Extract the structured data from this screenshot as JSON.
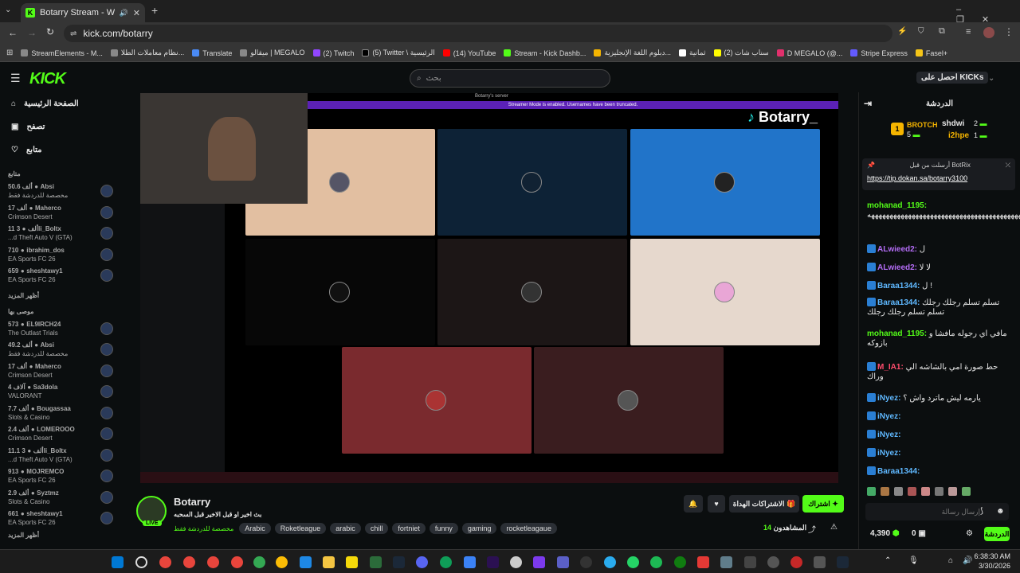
{
  "browser": {
    "tab_title": "Botarry Stream - Watch Live",
    "url": "kick.com/botarry",
    "bookmarks": [
      "StreamElements - M...",
      "نظام معاملات الطلا...",
      "Translate",
      "ميقالو | MEGALO",
      "(2) Twitch",
      "(5) Twitter \\ الرئيسية",
      "(14) YouTube",
      "Stream - Kick Dashb...",
      "دبلوم اللغة الإنجليزية...",
      "ثمانية",
      "(2) سناب شات",
      "D MEGALO (@...",
      "Stripe Express",
      "Fasel+"
    ]
  },
  "header": {
    "logo": "KICK",
    "search_placeholder": "بحث",
    "get_kicks": "احصل على KICKs"
  },
  "nav": {
    "home": "الصفحة الرئيسية",
    "browse": "تصفح",
    "following": "متابع"
  },
  "sidebar": {
    "following_title": "متابع",
    "following": [
      {
        "name": "Absi",
        "count": "50.6 ألف",
        "sub": "مخصصة للدردشة فقط"
      },
      {
        "name": "Maherco",
        "count": "17 ألف",
        "sub": "Crimson Desert"
      },
      {
        "name": "3li_Boltx",
        "count": "11 ألف",
        "sub": "...d Theft Auto V (GTA)"
      },
      {
        "name": "ibrahim_dos",
        "count": "710",
        "sub": "EA Sports FC 26"
      },
      {
        "name": "sheshtawy1",
        "count": "659",
        "sub": "EA Sports FC 26"
      }
    ],
    "show_more": "أظهر المزيد",
    "recommended_title": "موصى بها",
    "recommended": [
      {
        "name": "EL9IRCH24",
        "count": "573",
        "sub": "The Outlast Trials"
      },
      {
        "name": "Absi",
        "count": "49.2 ألف",
        "sub": "مخصصة للدردشة فقط"
      },
      {
        "name": "Maherco",
        "count": "17 ألف",
        "sub": "Crimson Desert"
      },
      {
        "name": "Sa3dola",
        "count": "4 آلاف",
        "sub": "VALORANT"
      },
      {
        "name": "Bougassaa",
        "count": "7.7 ألف",
        "sub": "Slots & Casino"
      },
      {
        "name": "LOMEROOO",
        "count": "2.4 ألف",
        "sub": "Crimson Desert"
      },
      {
        "name": "3li_Boltx",
        "count": "11.1 ألف",
        "sub": "...d Theft Auto V (GTA)"
      },
      {
        "name": "MOJREMCO",
        "count": "913",
        "sub": "EA Sports FC 26"
      },
      {
        "name": "Syztmz",
        "count": "2.9 ألف",
        "sub": "Slots & Casino"
      },
      {
        "name": "sheshtawy1",
        "count": "661",
        "sub": "EA Sports FC 26"
      }
    ],
    "show_more2": "أظهر المزيد"
  },
  "video": {
    "overlay_brand": "Botarry_",
    "banner": "Streamer Mode is enabled. Usernames have been truncated.",
    "server": "Botarry's server"
  },
  "stream": {
    "name": "Botarry",
    "title": "بث اخير او قبل الاخير قبل السحبه",
    "category": "مخصصة للدردشة فقط",
    "tags": [
      "Arabic",
      "Roketleague",
      "arabic",
      "chill",
      "fortniet",
      "funny",
      "gaming",
      "rocketleagaue"
    ],
    "follow": "اشتراك",
    "gift_subs": "الاشتراكات الهداة",
    "viewers_label": "المشاهدون",
    "viewers": "14"
  },
  "chat": {
    "title": "الدردشة",
    "leaderboard": [
      {
        "name": "BROTCH",
        "count": "5"
      },
      {
        "name": "shdwi",
        "count": "2"
      },
      {
        "name": "i2hpe",
        "count": "1"
      }
    ],
    "pinned_by": "أرسلت من قبل BotRix",
    "pinned_link": "https://tip.dokan.sa/botarry3100",
    "messages": [
      {
        "user": "mohanad_1195:",
        "text": "ههههههههههههههههههههههههههههههههههههههههههههههههه",
        "color": "#53fc18"
      },
      {
        "user": "ALwieed2:",
        "text": "ل",
        "color": "#b36cf5"
      },
      {
        "user": "ALwieed2:",
        "text": "لا لا",
        "color": "#b36cf5"
      },
      {
        "user": "Baraa1344:",
        "text": "ل !",
        "color": "#5fb8ff"
      },
      {
        "user": "Baraa1344:",
        "text": "تسلم تسلم رجلك رجلك تسلم تسلم رجلك رجلك",
        "color": "#5fb8ff"
      },
      {
        "user": "mohanad_1195:",
        "text": "مافي اي رجوله مافشا و بازوكه",
        "color": "#53fc18"
      },
      {
        "user": "M_IA1:",
        "text": "حط صورة امي بالشاشه الي وراك",
        "color": "#ff4d6d"
      },
      {
        "user": "iNyez:",
        "text": "يارمه ليش ماترد واش ؟",
        "color": "#5fb8ff"
      },
      {
        "user": "iNyez:",
        "text": "",
        "color": "#5fb8ff"
      },
      {
        "user": "iNyez:",
        "text": "",
        "color": "#5fb8ff"
      },
      {
        "user": "iNyez:",
        "text": "",
        "color": "#5fb8ff"
      },
      {
        "user": "Baraa1344:",
        "text": "",
        "color": "#5fb8ff"
      }
    ],
    "input_placeholder": "إرسال رسالة",
    "points": "4,390",
    "gifts": "0",
    "send": "الدردشة"
  },
  "taskbar": {
    "time": "6:38:30 AM",
    "date": "3/30/2026"
  }
}
